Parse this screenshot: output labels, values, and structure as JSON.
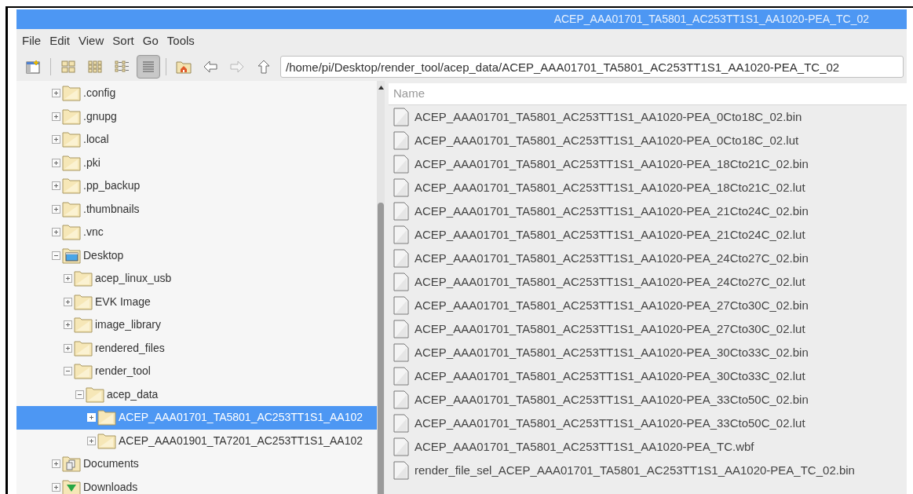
{
  "window": {
    "title": "ACEP_AAA01701_TA5801_AC253TT1S1_AA1020-PEA_TC_02"
  },
  "menu": [
    "File",
    "Edit",
    "View",
    "Sort",
    "Go",
    "Tools"
  ],
  "toolbar": [
    {
      "kind": "new-window",
      "selected": false,
      "disabled": false
    },
    {
      "kind": "icon-view",
      "selected": false,
      "disabled": false
    },
    {
      "kind": "thumbnail-view",
      "selected": false,
      "disabled": false
    },
    {
      "kind": "compact-view",
      "selected": false,
      "disabled": false
    },
    {
      "kind": "list-view",
      "selected": true,
      "disabled": false
    },
    {
      "kind": "home",
      "selected": false,
      "disabled": false
    },
    {
      "kind": "back",
      "selected": false,
      "disabled": false
    },
    {
      "kind": "forward",
      "selected": false,
      "disabled": true
    },
    {
      "kind": "up",
      "selected": false,
      "disabled": false
    }
  ],
  "path": {
    "value": "/home/pi/Desktop/render_tool/acep_data/ACEP_AAA01701_TA5801_AC253TT1S1_AA1020-PEA_TC_02"
  },
  "tree": [
    {
      "label": ".config",
      "kind": "folder",
      "expanded": false,
      "selected": false
    },
    {
      "label": ".gnupg",
      "kind": "folder",
      "expanded": false,
      "selected": false
    },
    {
      "label": ".local",
      "kind": "folder",
      "expanded": false,
      "selected": false
    },
    {
      "label": ".pki",
      "kind": "folder",
      "expanded": false,
      "selected": false
    },
    {
      "label": ".pp_backup",
      "kind": "folder",
      "expanded": false,
      "selected": false
    },
    {
      "label": ".thumbnails",
      "kind": "folder",
      "expanded": false,
      "selected": false
    },
    {
      "label": ".vnc",
      "kind": "folder",
      "expanded": false,
      "selected": false
    },
    {
      "label": "Desktop",
      "kind": "desktop",
      "expanded": true,
      "selected": false,
      "children": [
        {
          "label": "acep_linux_usb",
          "kind": "folder",
          "expanded": false,
          "selected": false
        },
        {
          "label": "EVK Image",
          "kind": "folder",
          "expanded": false,
          "selected": false
        },
        {
          "label": "image_library",
          "kind": "folder",
          "expanded": false,
          "selected": false
        },
        {
          "label": "rendered_files",
          "kind": "folder",
          "expanded": false,
          "selected": false
        },
        {
          "label": "render_tool",
          "kind": "folder",
          "expanded": true,
          "selected": false,
          "children": [
            {
              "label": "acep_data",
              "kind": "folder",
              "expanded": true,
              "selected": false,
              "children": [
                {
                  "label": "ACEP_AAA01701_TA5801_AC253TT1S1_AA102",
                  "kind": "folder",
                  "expanded": false,
                  "selected": true
                },
                {
                  "label": "ACEP_AAA01901_TA7201_AC253TT1S1_AA102",
                  "kind": "folder",
                  "expanded": false,
                  "selected": false
                }
              ]
            }
          ]
        }
      ]
    },
    {
      "label": "Documents",
      "kind": "documents",
      "expanded": false,
      "selected": false
    },
    {
      "label": "Downloads",
      "kind": "downloads",
      "expanded": false,
      "selected": false
    }
  ],
  "files": {
    "columns": [
      "Name"
    ],
    "rows": [
      "ACEP_AAA01701_TA5801_AC253TT1S1_AA1020-PEA_0Cto18C_02.bin",
      "ACEP_AAA01701_TA5801_AC253TT1S1_AA1020-PEA_0Cto18C_02.lut",
      "ACEP_AAA01701_TA5801_AC253TT1S1_AA1020-PEA_18Cto21C_02.bin",
      "ACEP_AAA01701_TA5801_AC253TT1S1_AA1020-PEA_18Cto21C_02.lut",
      "ACEP_AAA01701_TA5801_AC253TT1S1_AA1020-PEA_21Cto24C_02.bin",
      "ACEP_AAA01701_TA5801_AC253TT1S1_AA1020-PEA_21Cto24C_02.lut",
      "ACEP_AAA01701_TA5801_AC253TT1S1_AA1020-PEA_24Cto27C_02.bin",
      "ACEP_AAA01701_TA5801_AC253TT1S1_AA1020-PEA_24Cto27C_02.lut",
      "ACEP_AAA01701_TA5801_AC253TT1S1_AA1020-PEA_27Cto30C_02.bin",
      "ACEP_AAA01701_TA5801_AC253TT1S1_AA1020-PEA_27Cto30C_02.lut",
      "ACEP_AAA01701_TA5801_AC253TT1S1_AA1020-PEA_30Cto33C_02.bin",
      "ACEP_AAA01701_TA5801_AC253TT1S1_AA1020-PEA_30Cto33C_02.lut",
      "ACEP_AAA01701_TA5801_AC253TT1S1_AA1020-PEA_33Cto50C_02.bin",
      "ACEP_AAA01701_TA5801_AC253TT1S1_AA1020-PEA_33Cto50C_02.lut",
      "ACEP_AAA01701_TA5801_AC253TT1S1_AA1020-PEA_TC.wbf",
      "render_file_sel_ACEP_AAA01701_TA5801_AC253TT1S1_AA1020-PEA_TC_02.bin"
    ]
  }
}
